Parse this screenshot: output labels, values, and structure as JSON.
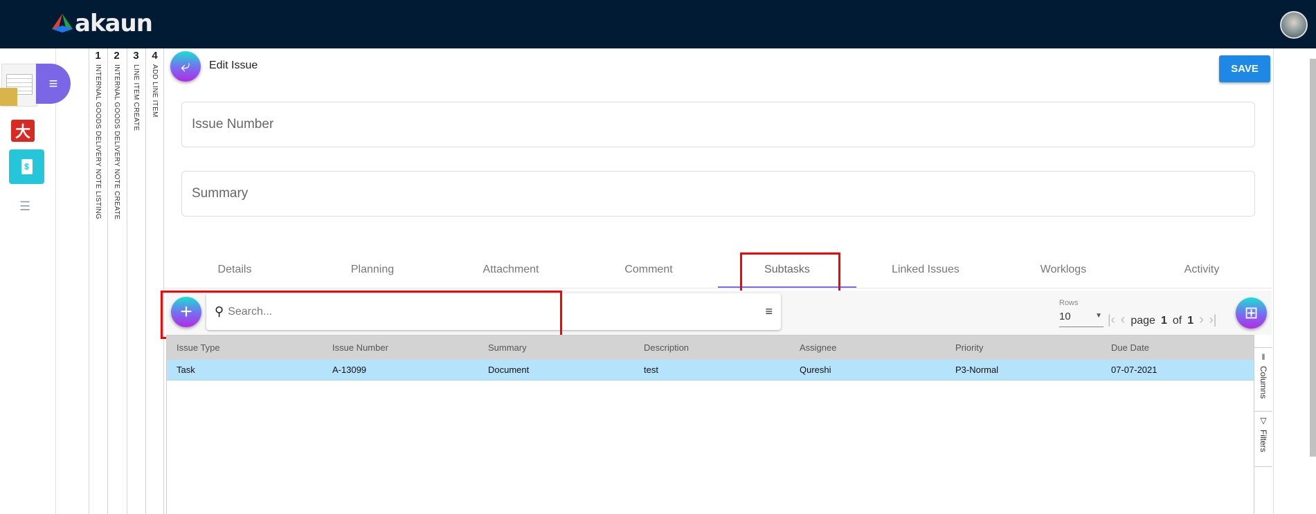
{
  "header": {
    "logo": "akaun"
  },
  "vertical_tabs": [
    {
      "num": "1",
      "label": "INTERNAL GOODS DELIVERY NOTE LISTING"
    },
    {
      "num": "2",
      "label": "INTERNAL GOODS DELIVERY NOTE CREATE"
    },
    {
      "num": "3",
      "label": "LINE ITEM CREATE"
    },
    {
      "num": "4",
      "label": "ADD LINE ITEM"
    }
  ],
  "page": {
    "title": "Edit Issue",
    "save_label": "SAVE"
  },
  "form": {
    "issue_number_placeholder": "Issue Number",
    "summary_placeholder": "Summary"
  },
  "tabs": [
    "Details",
    "Planning",
    "Attachment",
    "Comment",
    "Subtasks",
    "Linked Issues",
    "Worklogs",
    "Activity"
  ],
  "active_tab": "Subtasks",
  "toolbar": {
    "search_placeholder": "Search...",
    "rows_label": "Rows",
    "rows_value": "10",
    "page_word": "page",
    "page": "1",
    "of_word": "of",
    "total_pages": "1"
  },
  "table": {
    "columns": [
      "Issue Type",
      "Issue Number",
      "Summary",
      "Description",
      "Assignee",
      "Priority",
      "Due Date"
    ],
    "rows": [
      [
        "Task",
        "A-13099",
        "Document",
        "test",
        "Qureshi",
        "P3-Normal",
        "07-07-2021"
      ]
    ]
  },
  "side_panel": {
    "columns": "Columns",
    "filters": "Filters"
  },
  "colors": {
    "header": "#021b35",
    "accent": "#1e88e5",
    "selected_row": "#b5e3fb"
  }
}
